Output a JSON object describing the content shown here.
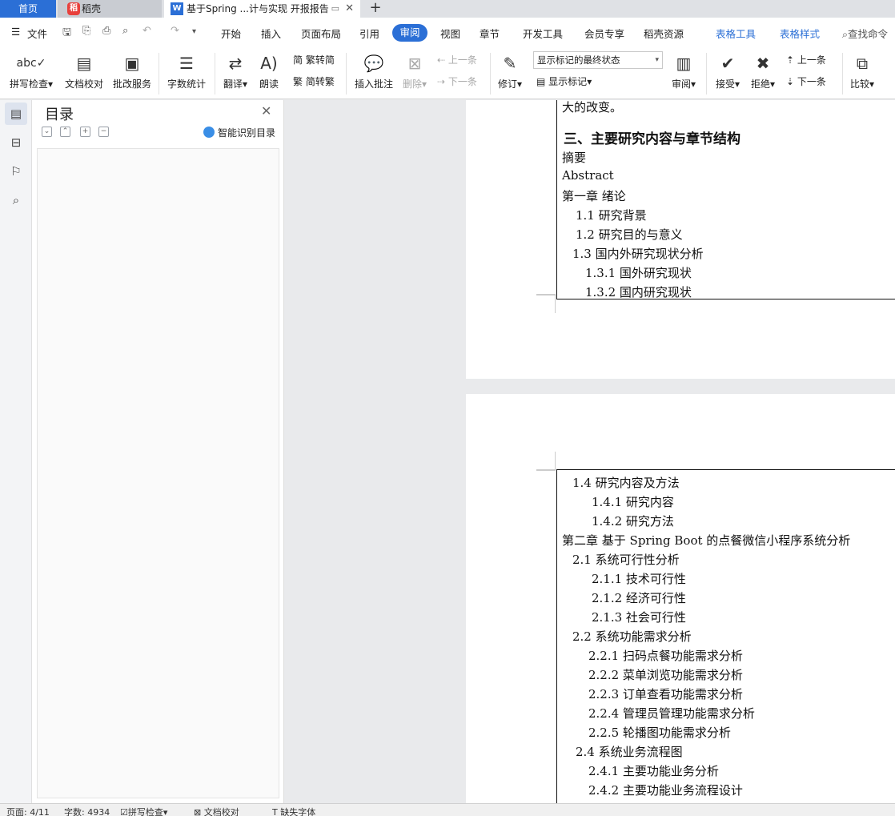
{
  "tabs": {
    "home": "首页",
    "daoke": "稻壳",
    "doc": "基于Spring ...计与实现 开报报告"
  },
  "menu": {
    "file": "文件",
    "items": [
      "开始",
      "插入",
      "页面布局",
      "引用",
      "审阅",
      "视图",
      "章节",
      "开发工具",
      "会员专享",
      "稻壳资源"
    ],
    "active": "审阅",
    "table_tools": "表格工具",
    "table_style": "表格样式",
    "search": "查找命令"
  },
  "ribbon": {
    "spell": "拼写检查",
    "proof": "文档校对",
    "correct": "批改服务",
    "wordcount": "字数统计",
    "translate": "翻译",
    "read": "朗读",
    "trad": "繁转简",
    "simp": "简转繁",
    "insert_comment": "插入批注",
    "delete": "删除",
    "prev_comment": "上一条",
    "next_comment": "下一条",
    "revise": "修订",
    "markup_state": "显示标记的最终状态",
    "show_markup": "显示标记",
    "review": "审阅",
    "accept": "接受",
    "reject": "拒绝",
    "prev_change": "上一条",
    "next_change": "下一条",
    "compare": "比较"
  },
  "toc": {
    "title": "目录",
    "smart": "智能识别目录"
  },
  "page1": {
    "tail": "大的改变。",
    "heading": "三、主要研究内容与章节结构",
    "lines": [
      "摘要",
      "Abstract",
      "第一章 绪论",
      "1.1 研究背景",
      "1.2 研究目的与意义",
      "1.3 国内外研究现状分析",
      "1.3.1 国外研究现状",
      "1.3.2 国内研究现状"
    ]
  },
  "page2": {
    "lines": [
      "1.4 研究内容及方法",
      "1.4.1 研究内容",
      "1.4.2 研究方法",
      "第二章 基于 Spring Boot 的点餐微信小程序系统分析",
      "2.1 系统可行性分析",
      "2.1.1 技术可行性",
      "2.1.2 经济可行性",
      "2.1.3 社会可行性",
      "2.2 系统功能需求分析",
      "2.2.1 扫码点餐功能需求分析",
      "2.2.2 菜单浏览功能需求分析",
      "2.2.3 订单查看功能需求分析",
      "2.2.4 管理员管理功能需求分析",
      "2.2.5 轮播图功能需求分析",
      "2.4 系统业务流程图",
      "2.4.1 主要功能业务分析",
      "2.4.2 主要功能业务流程设计"
    ]
  },
  "status": {
    "page": "页面: 4/11",
    "words": "字数: 4934",
    "spell": "拼写检查",
    "proof": "文档校对",
    "missing_font": "缺失字体"
  }
}
